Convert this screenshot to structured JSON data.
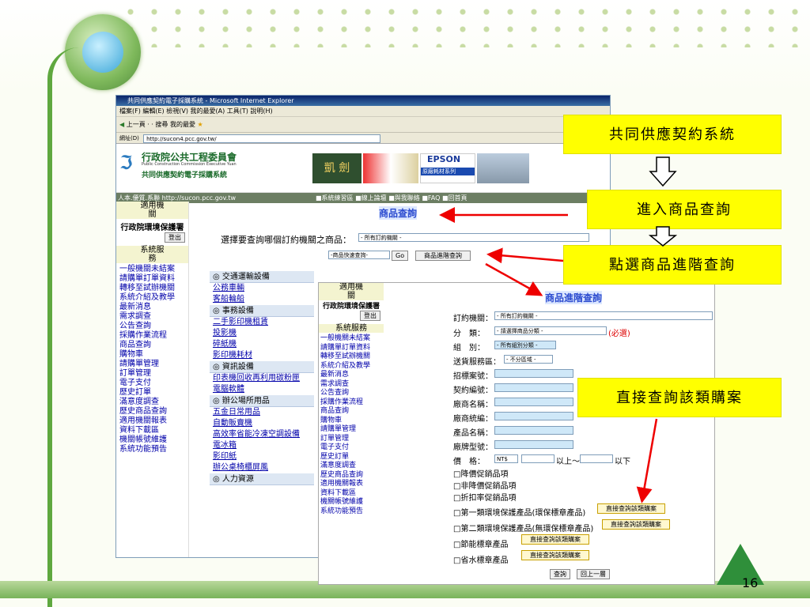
{
  "ie": {
    "title": "共同供應契約電子採購系統 - Microsoft Internet Explorer",
    "menu": "檔案(F)  編輯(E)  檢視(V)  我的最愛(A)  工具(T)  說明(H)",
    "toolbar": "上一頁 ·   ·  搜尋  我的最愛",
    "address_label": "網址(D)",
    "address": "http://sucon4.pcc.gov.tw/"
  },
  "banner": {
    "org": "行政院公共工程委員會",
    "org_en": "Public Construction Commission Executive Yuan",
    "system": "共同供應契約電子採購系統",
    "ad_epson": "EPSON",
    "ad_epson_sub": "原廠耗材系列",
    "ad_left": "凱 劍"
  },
  "navbar": {
    "left": "人本.優質.系聯    http://sucon.pcc.gov.tw",
    "links": [
      "■系統練習區",
      "■線上論壇",
      "■與我聯絡",
      "■FAQ",
      "■回首頁"
    ]
  },
  "sidebar": {
    "applicable_header": "適用機關",
    "agency": "行政院環境保護署",
    "logout": "登出",
    "service_header": "系統服務",
    "links": [
      "一般機關未結案",
      "請購單訂單資料",
      "轉移至試辦機關",
      "系統介紹及教學",
      "最新消息",
      "需求調查",
      "公告查詢",
      "採購作業流程",
      "商品查詢",
      "購物車",
      "請購單管理",
      "訂單管理",
      "電子支付",
      "歷史訂單",
      "滿意度調查",
      "歷史商品查詢",
      "適用機關報表",
      "資料下載區",
      "機關帳號維護",
      "系統功能預告"
    ]
  },
  "main": {
    "title": "商品查詢",
    "select_prompt": "選擇要查詢哪個訂約機關之商品：",
    "select_value": "- 所有訂約機關 -",
    "quick_search": "-商品快速查詢-",
    "go": "Go",
    "advanced_btn": "商品進階查詢",
    "categories": [
      {
        "name": "◎ 交通運輸設備",
        "items": [
          "公務車輛",
          "客船輪船"
        ]
      },
      {
        "name": "◎ 事務設備",
        "items": [
          "二手影印機租賃",
          "投影機",
          "碎紙機",
          "影印機耗材"
        ]
      },
      {
        "name": "◎ 資訊設備",
        "items": [
          "印表機回收再利用碳粉匣",
          "電腦軟體"
        ]
      },
      {
        "name": "◎ 辦公場所用品",
        "items": [
          "五金日常用品",
          "自動販賣機",
          "高效率省能冷凍空調設備",
          "電冰箱",
          "影印紙",
          "辦公桌椅櫃屏風"
        ]
      },
      {
        "name": "◎ 人力資源",
        "items": []
      }
    ]
  },
  "panel2": {
    "title": "商品進階查詢",
    "sidebar_links": [
      "一般機關未結案",
      "請購單訂單資料",
      "轉移至試辦機關",
      "系統介紹及教學",
      "最新消息",
      "需求調查",
      "公告查詢",
      "採購作業流程",
      "商品查詢",
      "購物車",
      "請購單管理",
      "訂單管理",
      "電子支付",
      "歷史訂單",
      "滿意度調查",
      "歷史商品查詢",
      "適用機關報表",
      "資料下載區",
      "機關帳號維護",
      "系統功能預告"
    ],
    "fields": {
      "agency_label": "訂約機關：",
      "agency_value": "- 所有訂約機關 -",
      "category_label": "分　類：",
      "category_value": "- 請選擇商品分類 -",
      "required": "(必選)",
      "group_label": "組　別：",
      "group_value": "- 所有組別分類 -",
      "region_label": "送貨服務區：",
      "region_value": "- 不分區域 -",
      "tender_label": "招標案號：",
      "contract_label": "契約編號：",
      "vendor_label": "廠商名稱：",
      "vendor_id_label": "廠商統編：",
      "product_label": "產品名稱：",
      "brand_label": "廠牌型號：",
      "price_label": "價　格：",
      "currency": "NT$",
      "above": "以上～",
      "below": "以下",
      "promo1": "□降價促銷品項",
      "promo2": "□非降價促銷品項",
      "promo3": "□折扣率促銷品項",
      "eco1": "□第一類環境保護產品(環保標章產品)",
      "eco2": "□第二類環境保護產品(無環保標章產品)",
      "eco3": "□節能標章產品",
      "eco4": "□省水標章產品",
      "direct_btn": "直接查詢該類購案",
      "search": "查詢",
      "back": "回上一層"
    }
  },
  "callouts": {
    "c1": "共同供應契約系統",
    "c2": "進入商品查詢",
    "c3": "點選商品進階查詢",
    "c4": "直接查詢該類購案"
  },
  "slide_number": "16"
}
